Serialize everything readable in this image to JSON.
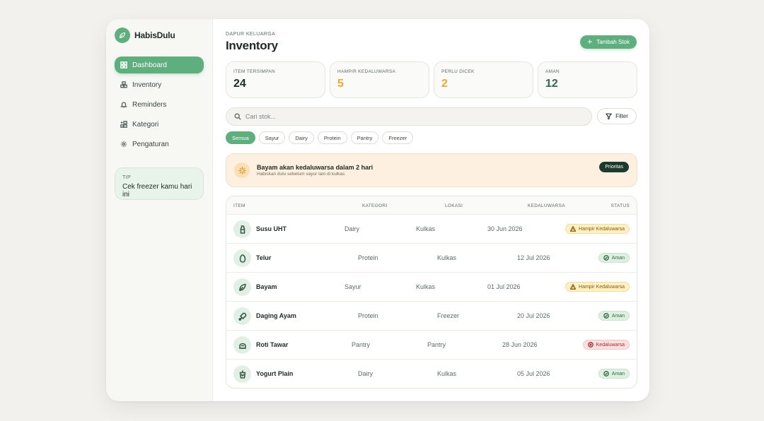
{
  "brand": {
    "name": "HabisDulu"
  },
  "nav": [
    {
      "label": "Dashboard",
      "icon": "dashboard-icon",
      "active": true
    },
    {
      "label": "Inventory",
      "icon": "boxes-icon",
      "active": false
    },
    {
      "label": "Reminders",
      "icon": "bell-icon",
      "active": false
    },
    {
      "label": "Kategori",
      "icon": "category-icon",
      "active": false
    },
    {
      "label": "Pengaturan",
      "icon": "gear-icon",
      "active": false
    }
  ],
  "tip": {
    "label": "TIP",
    "text": "Cek freezer kamu hari ini"
  },
  "header": {
    "eyebrow": "DAPUR KELUARGA",
    "title": "Inventory",
    "add_label": "Tambah Stok"
  },
  "stats": [
    {
      "label": "ITEM TERSIMPAN",
      "value": "24",
      "color": "#1f2a24"
    },
    {
      "label": "HAMPIR KEDALUWARSA",
      "value": "5",
      "color": "#f0a531"
    },
    {
      "label": "PERLU DICEK",
      "value": "2",
      "color": "#f0a531"
    },
    {
      "label": "AMAN",
      "value": "12",
      "color": "#2f6a45"
    }
  ],
  "search": {
    "placeholder": "Cari stok...",
    "filter_label": "Filter"
  },
  "chips": [
    "Semua",
    "Sayur",
    "Dairy",
    "Protein",
    "Pantry",
    "Freezer"
  ],
  "alert": {
    "title": "Bayam akan kedaluwarsa dalam 2 hari",
    "subtitle": "Habiskan dulu sebelum sayur lain di kulkas",
    "action": "Prioritas"
  },
  "table": {
    "columns": [
      "ITEM",
      "KATEGORI",
      "LOKASI",
      "KEDALUWARSA",
      "STATUS"
    ],
    "rows": [
      {
        "name": "Susu UHT",
        "kategori": "Dairy",
        "lokasi": "Kulkas",
        "kedaluwarsa": "30 Jun 2026",
        "status": "Hampir Kedaluwarsa",
        "status_type": "warn",
        "icon": "milk-icon"
      },
      {
        "name": "Telur",
        "kategori": "Protein",
        "lokasi": "Kulkas",
        "kedaluwarsa": "12 Jul 2026",
        "status": "Aman",
        "status_type": "ok",
        "icon": "egg-icon"
      },
      {
        "name": "Bayam",
        "kategori": "Sayur",
        "lokasi": "Kulkas",
        "kedaluwarsa": "01 Jul 2026",
        "status": "Hampir Kedaluwarsa",
        "status_type": "warn",
        "icon": "leaf-icon"
      },
      {
        "name": "Daging Ayam",
        "kategori": "Protein",
        "lokasi": "Freezer",
        "kedaluwarsa": "20 Jul 2026",
        "status": "Aman",
        "status_type": "ok",
        "icon": "drumstick-icon"
      },
      {
        "name": "Roti Tawar",
        "kategori": "Pantry",
        "lokasi": "Pantry",
        "kedaluwarsa": "28 Jun 2026",
        "status": "Kedaluwarsa",
        "status_type": "bad",
        "icon": "bread-icon"
      },
      {
        "name": "Yogurt Plain",
        "kategori": "Dairy",
        "lokasi": "Kulkas",
        "kedaluwarsa": "05 Jul 2026",
        "status": "Aman",
        "status_type": "ok",
        "icon": "cup-icon"
      }
    ]
  },
  "colors": {
    "accent": "#5fae7e",
    "dark": "#1c3a2e",
    "warn": "#f0a531"
  }
}
